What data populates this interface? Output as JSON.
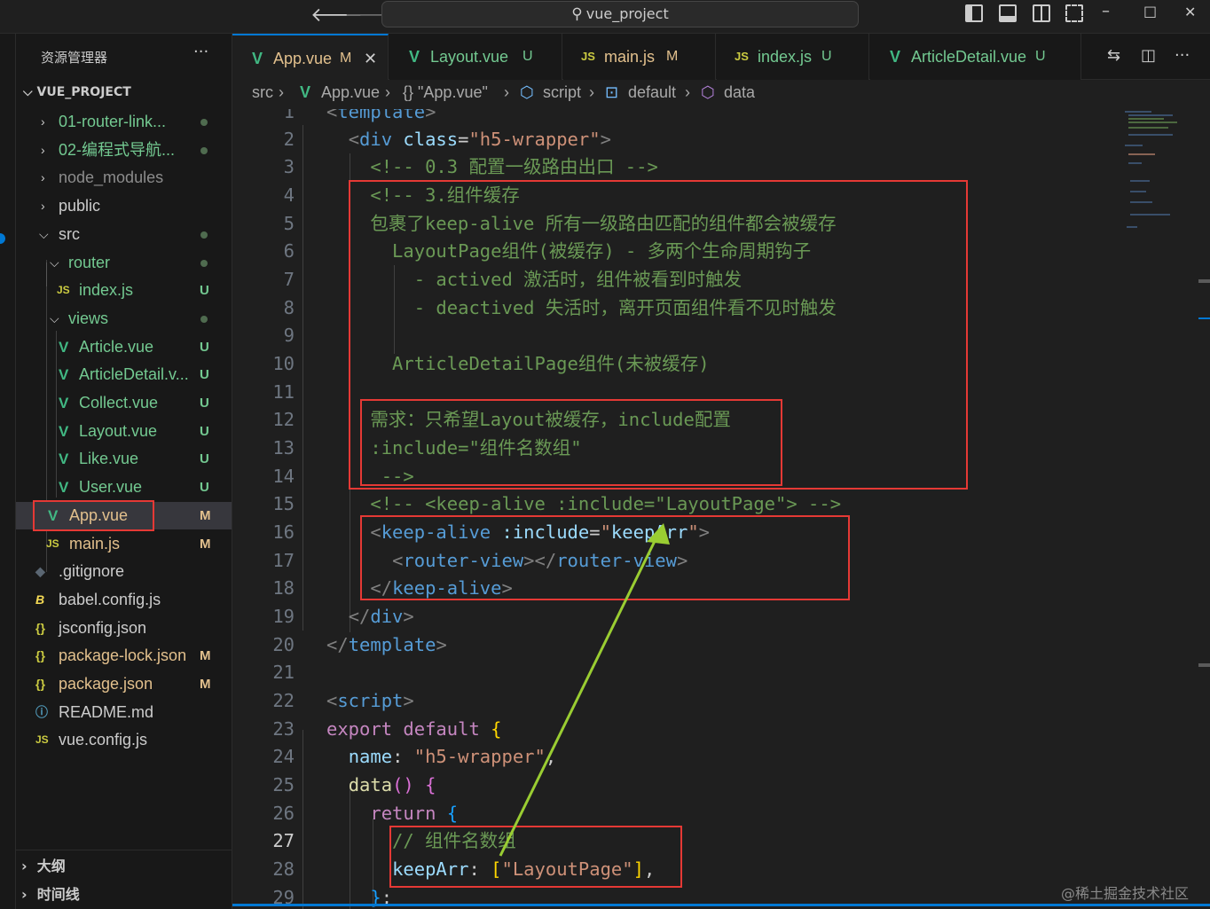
{
  "titlebar": {
    "back_icon": "arrow-left-icon",
    "forward_icon": "arrow-right-icon",
    "search_text": "vue_project",
    "minimize": "–",
    "maximize": "□",
    "close": "✕"
  },
  "sidebar": {
    "title": "资源管理器",
    "more": "···",
    "project": "VUE_PROJECT",
    "tree": [
      {
        "label": "01-router-link...",
        "status": "dot",
        "color": "#73c991"
      },
      {
        "label": "02-编程式导航...",
        "status": "dot",
        "color": "#73c991"
      },
      {
        "label": "node_modules",
        "status": "",
        "color": "#8c8c8c"
      },
      {
        "label": "public",
        "status": "",
        "color": "#cccccc"
      },
      {
        "label": "src",
        "status": "dot",
        "color": "#cccccc"
      },
      {
        "label": "router",
        "status": "dot",
        "color": "#73c991"
      },
      {
        "label": "index.js",
        "status": "U",
        "color": "#73c991"
      },
      {
        "label": "views",
        "status": "dot",
        "color": "#73c991"
      },
      {
        "label": "Article.vue",
        "status": "U",
        "color": "#73c991"
      },
      {
        "label": "ArticleDetail.v...",
        "status": "U",
        "color": "#73c991"
      },
      {
        "label": "Collect.vue",
        "status": "U",
        "color": "#73c991"
      },
      {
        "label": "Layout.vue",
        "status": "U",
        "color": "#73c991"
      },
      {
        "label": "Like.vue",
        "status": "U",
        "color": "#73c991"
      },
      {
        "label": "User.vue",
        "status": "U",
        "color": "#73c991"
      },
      {
        "label": "App.vue",
        "status": "M",
        "color": "#e2c08d"
      },
      {
        "label": "main.js",
        "status": "M",
        "color": "#e2c08d"
      },
      {
        "label": ".gitignore",
        "status": "",
        "color": "#cccccc"
      },
      {
        "label": "babel.config.js",
        "status": "",
        "color": "#cccccc"
      },
      {
        "label": "jsconfig.json",
        "status": "",
        "color": "#cccccc"
      },
      {
        "label": "package-lock.json",
        "status": "M",
        "color": "#e2c08d"
      },
      {
        "label": "package.json",
        "status": "M",
        "color": "#e2c08d"
      },
      {
        "label": "README.md",
        "status": "",
        "color": "#cccccc"
      },
      {
        "label": "vue.config.js",
        "status": "",
        "color": "#cccccc"
      }
    ],
    "outline": "大纲",
    "timeline": "时间线"
  },
  "tabs": [
    {
      "label": "App.vue",
      "status": "M",
      "icon": "vue-icon",
      "active": true
    },
    {
      "label": "Layout.vue",
      "status": "U",
      "icon": "vue-icon",
      "active": false
    },
    {
      "label": "main.js",
      "status": "M",
      "icon": "js-icon",
      "active": false
    },
    {
      "label": "index.js",
      "status": "U",
      "icon": "js-icon",
      "active": false
    },
    {
      "label": "ArticleDetail.vue",
      "status": "U",
      "icon": "vue-icon",
      "active": false
    }
  ],
  "icon_glyphs": {
    "vue": "V",
    "js": "JS",
    "braces": "{}",
    "info": "ⓘ",
    "babel": "B",
    "git": "◆"
  },
  "breadcrumbs": [
    "src",
    "App.vue",
    "{} \"App.vue\"",
    "script",
    "default",
    "data"
  ],
  "editor": {
    "current_line": 27,
    "line_numbers": [
      "1",
      "2",
      "3",
      "4",
      "5",
      "6",
      "7",
      "8",
      "9",
      "10",
      "11",
      "12",
      "13",
      "14",
      "15",
      "16",
      "17",
      "18",
      "19",
      "20",
      "21",
      "22",
      "23",
      "24",
      "25",
      "26",
      "27",
      "28",
      "29"
    ]
  },
  "colors": {
    "accent": "#0078d4",
    "annotation": "#e53935",
    "arrow": "#9acd32",
    "modified": "#e2c08d",
    "untracked": "#73c991",
    "vue_green": "#41b883",
    "js_yellow": "#cbcb41"
  },
  "watermark": "@稀土掘金技术社区"
}
